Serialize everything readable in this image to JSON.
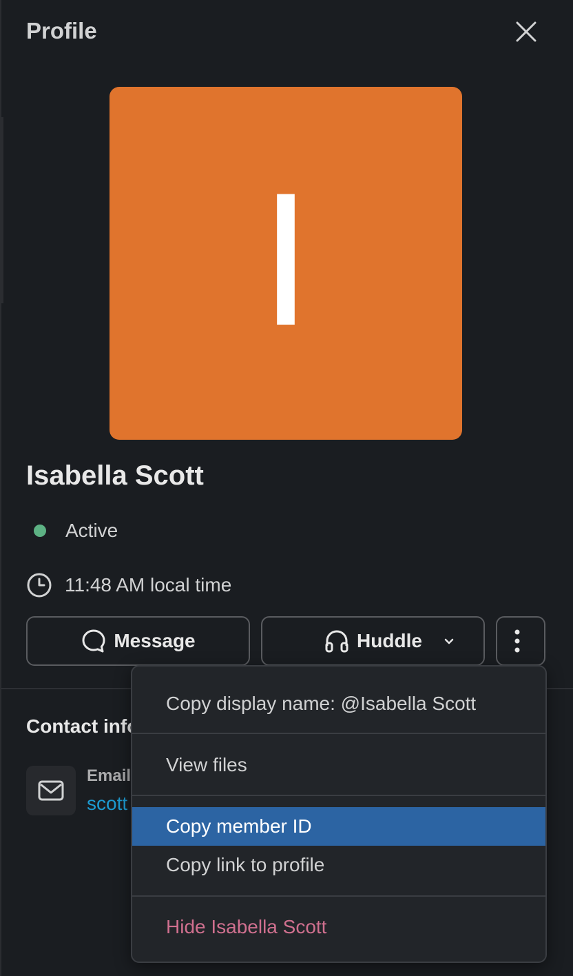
{
  "header": {
    "title": "Profile"
  },
  "icons": {
    "close": "close-icon",
    "message": "message-bubble-icon",
    "huddle": "headphones-icon",
    "more": "more-vertical-icon",
    "clock": "clock-icon",
    "email": "envelope-icon"
  },
  "avatar": {
    "initial": "I",
    "background": "#e0742d"
  },
  "profile": {
    "name": "Isabella Scott",
    "status": "Active",
    "status_color": "#5db284",
    "local_time": "11:48 AM local time"
  },
  "actions": {
    "message_label": "Message",
    "huddle_label": "Huddle"
  },
  "contact": {
    "section_title": "Contact information",
    "email_label": "Email Address",
    "email_value": "scott"
  },
  "menu": {
    "items": [
      {
        "label": "Copy display name: @Isabella Scott"
      },
      {
        "label": "View files"
      },
      {
        "label": "Copy member ID",
        "highlighted": true
      },
      {
        "label": "Copy link to profile"
      },
      {
        "label": "Hide Isabella Scott",
        "danger": true
      }
    ],
    "highlight_color": "#2c64a3",
    "danger_color": "#d0708f"
  }
}
